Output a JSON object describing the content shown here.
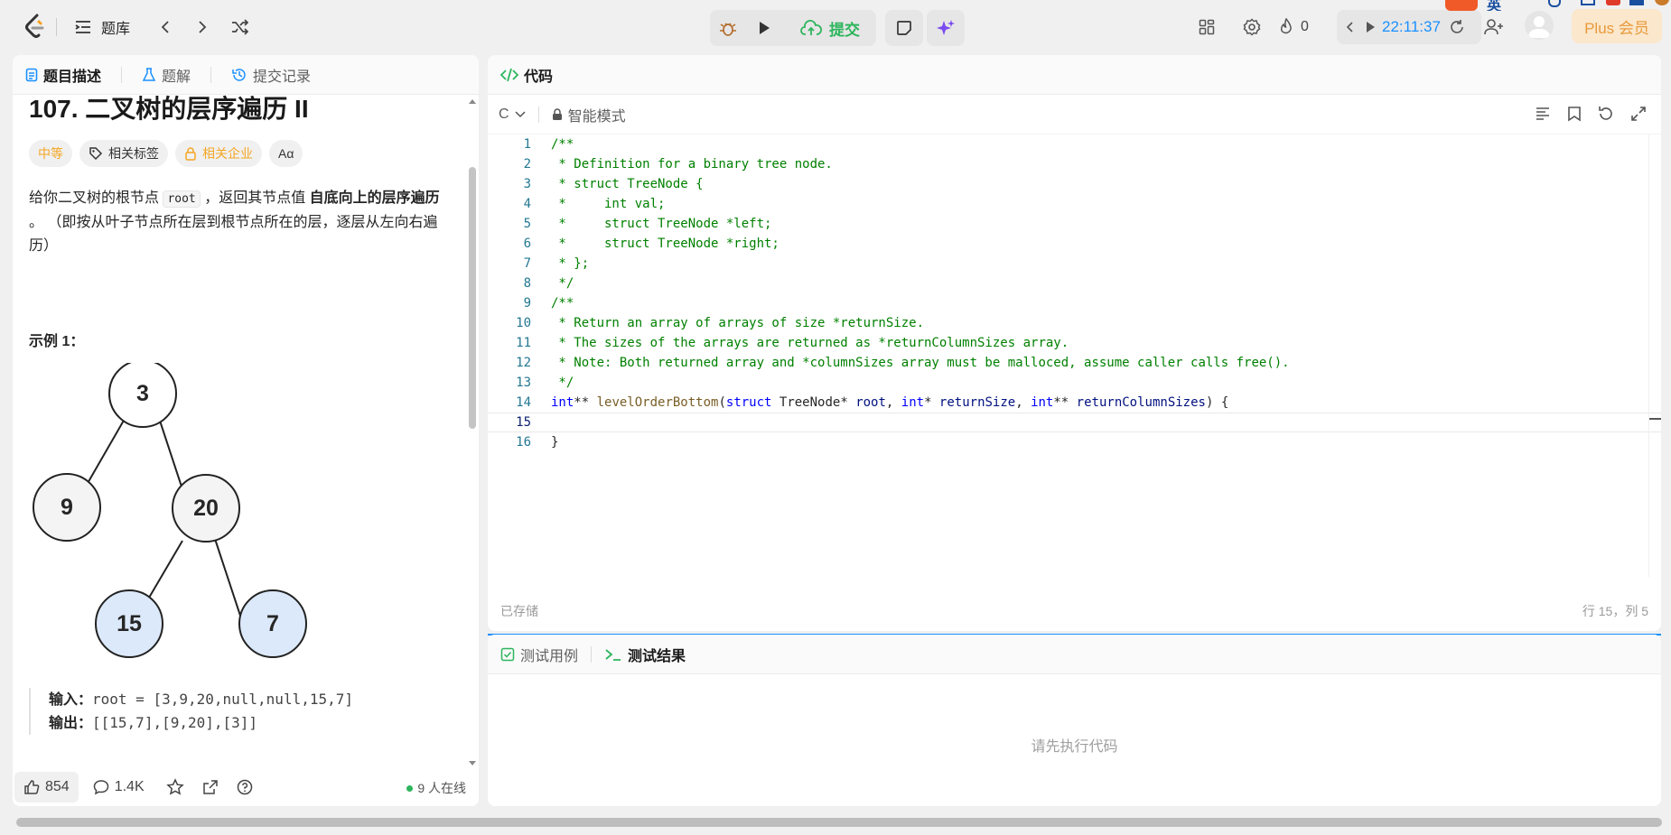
{
  "topbar": {
    "problem_list": "题库",
    "submit_label": "提交",
    "fire_count": "0",
    "timer": "22:11:37",
    "plus_label": "Plus 会员",
    "ime_label": "英"
  },
  "left": {
    "tabs": [
      "题目描述",
      "题解",
      "提交记录"
    ],
    "title": "107. 二叉树的层序遍历 II",
    "chips": {
      "difficulty": "中等",
      "tags": "相关标签",
      "company": "相关企业",
      "font": "Aα"
    },
    "desc_pre": "给你二叉树的根节点 ",
    "desc_code": "root",
    "desc_mid": " ，返回其节点值 ",
    "desc_bold": "自底向上的层序遍历",
    "desc_post": " 。 （即按从叶子节点所在层到根节点所在的层，逐层从左向右遍历）",
    "example_heading": "示例 1：",
    "tree_nodes": [
      "3",
      "9",
      "20",
      "15",
      "7"
    ],
    "input_label": "输入：",
    "input_value": "root = [3,9,20,null,null,15,7]",
    "output_label": "输出：",
    "output_value": "[[15,7],[9,20],[3]]",
    "footer": {
      "likes": "854",
      "comments": "1.4K",
      "online": "9 人在线"
    }
  },
  "code": {
    "tab": "代码",
    "language": "C",
    "mode": "智能模式",
    "saved": "已存储",
    "position": "行 15，列 5",
    "line_numbers": [
      "1",
      "2",
      "3",
      "4",
      "5",
      "6",
      "7",
      "8",
      "9",
      "10",
      "11",
      "12",
      "13",
      "14",
      "15",
      "16"
    ]
  },
  "result": {
    "tabs": [
      "测试用例",
      "测试结果"
    ],
    "placeholder": "请先执行代码"
  },
  "colors": {
    "accent_blue": "#1a90ff",
    "green": "#2db55d",
    "orange": "#f5a623",
    "node_blue": "#dce9fb"
  }
}
